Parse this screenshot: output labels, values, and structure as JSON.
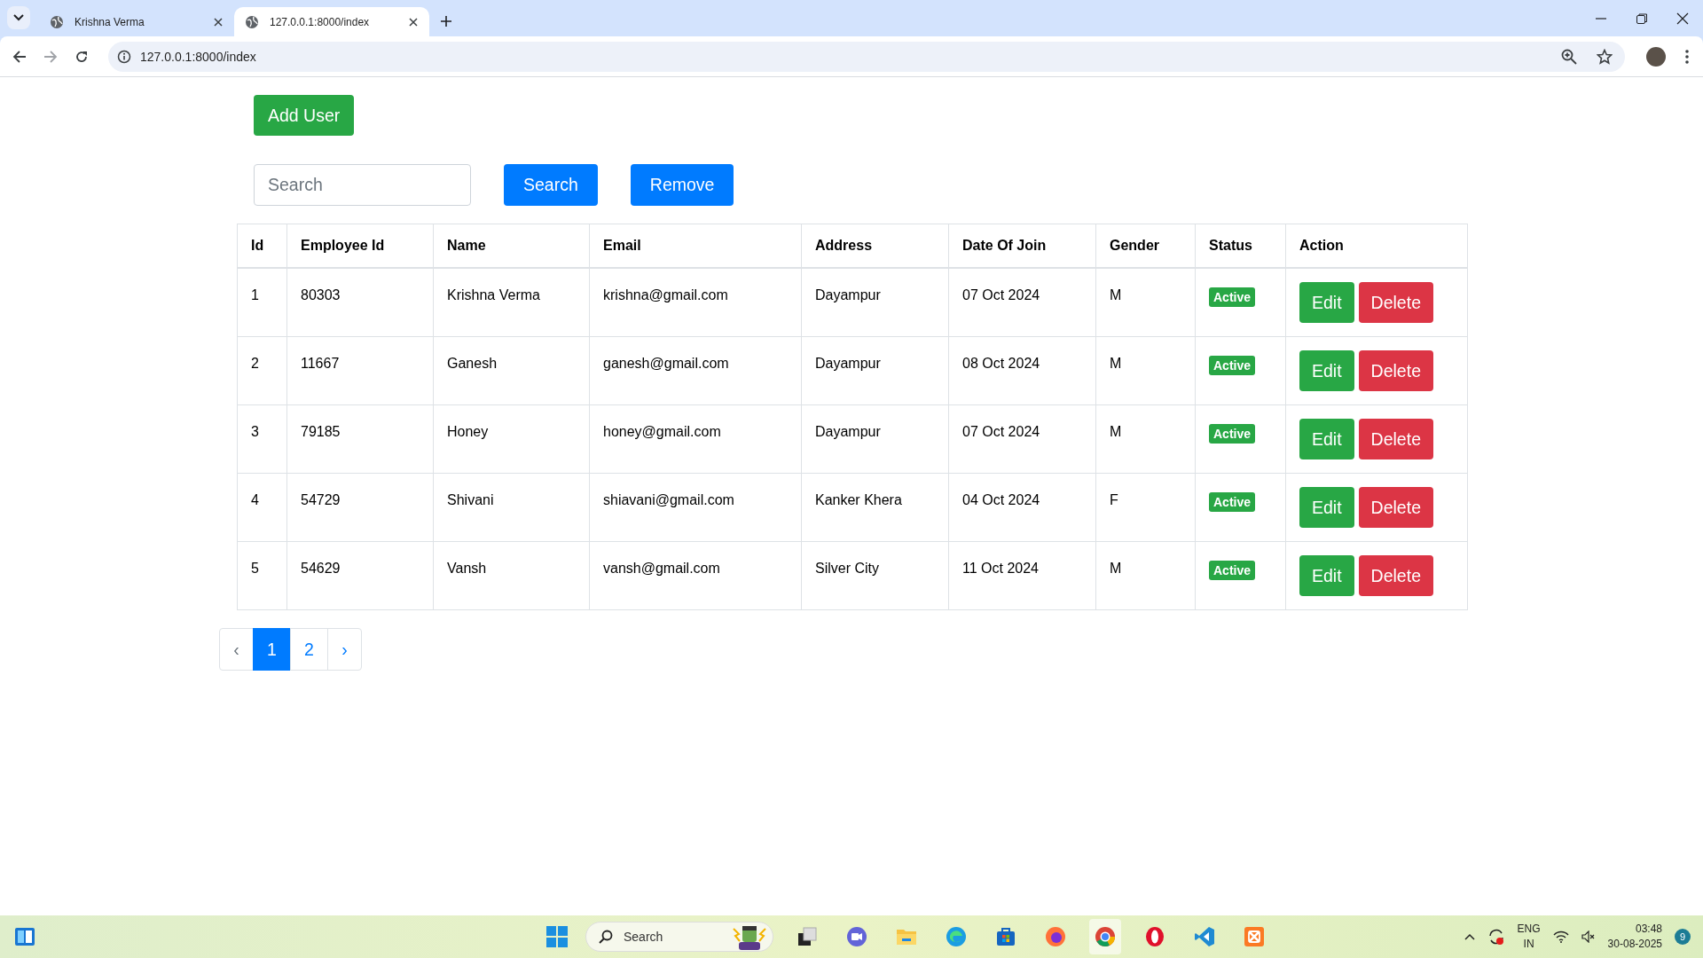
{
  "browser": {
    "tabs": [
      {
        "title": "Krishna Verma",
        "selected": false
      },
      {
        "title": "127.0.0.1:8000/index",
        "selected": true
      }
    ],
    "address": "127.0.0.1:8000/index"
  },
  "page": {
    "add_button": "Add User",
    "search": {
      "placeholder": "Search"
    },
    "search_button": "Search",
    "remove_button": "Remove",
    "table": {
      "columns": [
        "Id",
        "Employee Id",
        "Name",
        "Email",
        "Address",
        "Date Of Join",
        "Gender",
        "Status",
        "Action"
      ],
      "rows": [
        {
          "id": "1",
          "employee_id": "80303",
          "name": "Krishna Verma",
          "email": "krishna@gmail.com",
          "address": "Dayampur",
          "date_of_join": "07 Oct 2024",
          "gender": "M",
          "status": "Active",
          "actions": [
            "Edit",
            "Delete"
          ]
        },
        {
          "id": "2",
          "employee_id": "11667",
          "name": "Ganesh",
          "email": "ganesh@gmail.com",
          "address": "Dayampur",
          "date_of_join": "08 Oct 2024",
          "gender": "M",
          "status": "Active",
          "actions": [
            "Edit",
            "Delete"
          ]
        },
        {
          "id": "3",
          "employee_id": "79185",
          "name": "Honey",
          "email": "honey@gmail.com",
          "address": "Dayampur",
          "date_of_join": "07 Oct 2024",
          "gender": "M",
          "status": "Active",
          "actions": [
            "Edit",
            "Delete"
          ]
        },
        {
          "id": "4",
          "employee_id": "54729",
          "name": "Shivani",
          "email": "shiavani@gmail.com",
          "address": "Kanker Khera",
          "date_of_join": "04 Oct 2024",
          "gender": "F",
          "status": "Active",
          "actions": [
            "Edit",
            "Delete"
          ]
        },
        {
          "id": "5",
          "employee_id": "54629",
          "name": "Vansh",
          "email": "vansh@gmail.com",
          "address": "Silver City",
          "date_of_join": "11 Oct 2024",
          "gender": "M",
          "status": "Active",
          "actions": [
            "Edit",
            "Delete"
          ]
        }
      ]
    },
    "pagination": [
      {
        "label": "‹",
        "kind": "prev",
        "selected": false,
        "disabled": true
      },
      {
        "label": "1",
        "kind": "page",
        "selected": true,
        "disabled": false
      },
      {
        "label": "2",
        "kind": "page",
        "selected": false,
        "disabled": false
      },
      {
        "label": "›",
        "kind": "next",
        "selected": false,
        "disabled": false
      }
    ]
  },
  "taskbar": {
    "search": {
      "placeholder": "Search"
    },
    "language": "ENG",
    "region": "IN",
    "time": "03:48",
    "date": "30-08-2025",
    "notifications": "9"
  }
}
